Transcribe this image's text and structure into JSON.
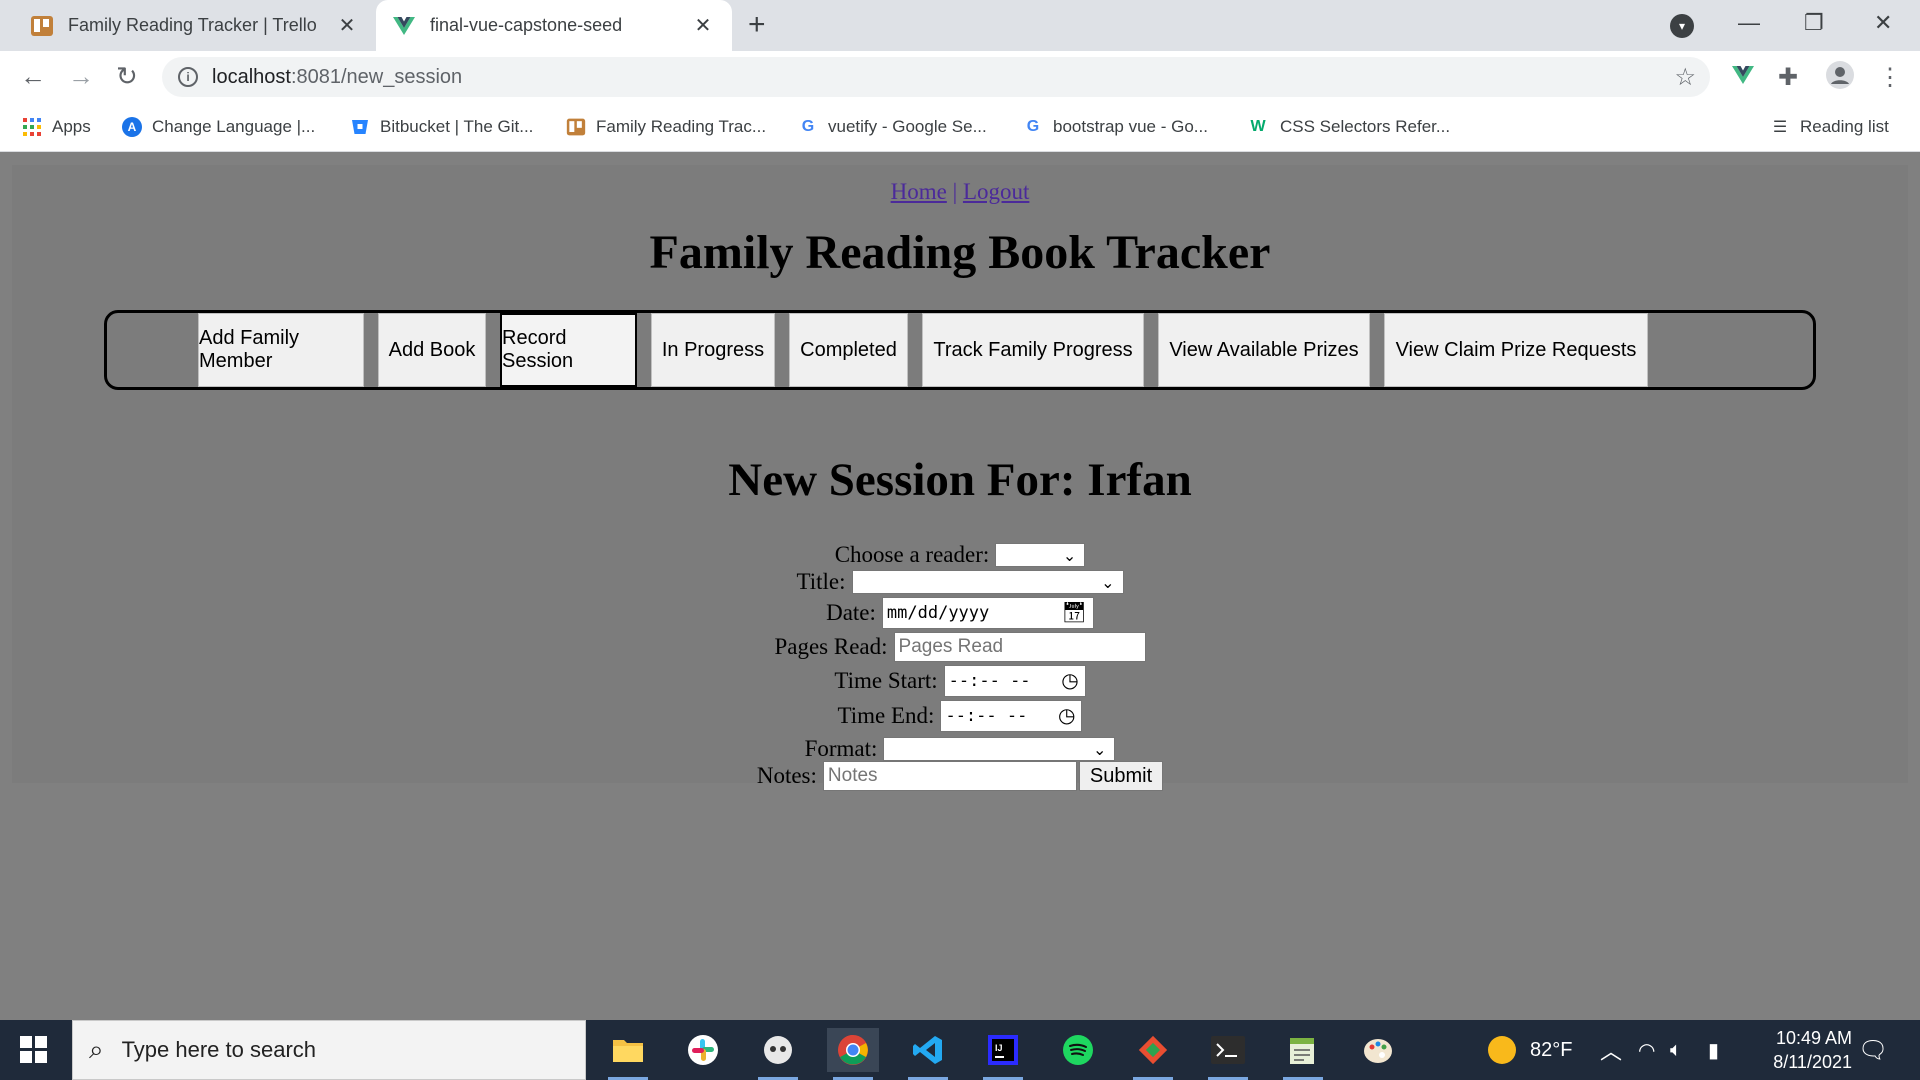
{
  "browser": {
    "tabs": [
      {
        "title": "Family Reading Tracker | Trello",
        "favicon": "trello-icon",
        "active": false
      },
      {
        "title": "final-vue-capstone-seed",
        "favicon": "vue-icon",
        "active": true
      }
    ],
    "url_host": "localhost",
    "url_path": ":8081/new_session",
    "bookmarks": [
      {
        "label": "Apps",
        "icon": "apps-grid-icon"
      },
      {
        "label": "Change Language |...",
        "icon": "change-language-icon"
      },
      {
        "label": "Bitbucket | The Git...",
        "icon": "bitbucket-icon"
      },
      {
        "label": "Family Reading Trac...",
        "icon": "trello-icon"
      },
      {
        "label": "vuetify - Google Se...",
        "icon": "google-icon"
      },
      {
        "label": "bootstrap vue - Go...",
        "icon": "google-icon"
      },
      {
        "label": "CSS Selectors Refer...",
        "icon": "w3schools-icon"
      }
    ],
    "reading_list": "Reading list"
  },
  "page": {
    "nav": {
      "home": "Home",
      "separator": "|",
      "logout": "Logout"
    },
    "title": "Family Reading Book Tracker",
    "menu": [
      {
        "label": "Add Family Member",
        "active": false
      },
      {
        "label": "Add Book",
        "active": false
      },
      {
        "label": "Record Session",
        "active": true
      },
      {
        "label": "In Progress",
        "active": false
      },
      {
        "label": "Completed",
        "active": false
      },
      {
        "label": "Track Family Progress",
        "active": false
      },
      {
        "label": "View Available Prizes",
        "active": false
      },
      {
        "label": "View Claim Prize Requests",
        "active": false
      }
    ],
    "session_heading": "New Session For: Irfan",
    "form": {
      "reader_label": "Choose a reader:",
      "reader_value": "",
      "title_label": "Title:",
      "title_value": "",
      "date_label": "Date:",
      "date_value": "mm/dd/yyyy",
      "pages_label": "Pages Read:",
      "pages_placeholder": "Pages Read",
      "time_start_label": "Time Start:",
      "time_start_value": "--:-- --",
      "time_end_label": "Time End:",
      "time_end_value": "--:-- --",
      "format_label": "Format:",
      "format_value": "",
      "notes_label": "Notes:",
      "notes_placeholder": "Notes",
      "submit_label": "Submit"
    }
  },
  "taskbar": {
    "search_placeholder": "Type here to search",
    "weather": "82°F",
    "time": "10:49 AM",
    "date": "8/11/2021",
    "apps": [
      "file-explorer-icon",
      "slack-icon",
      "chat-bubble-icon",
      "chrome-icon",
      "vscode-icon",
      "intellij-icon",
      "spotify-icon",
      "git-icon",
      "terminal-icon",
      "notepad-icon",
      "paint-icon"
    ]
  },
  "colors": {
    "page_bg": "#808080",
    "app_bg": "#7c7c7c",
    "link": "#4b2a9a",
    "taskbar": "#1f2a3a"
  }
}
